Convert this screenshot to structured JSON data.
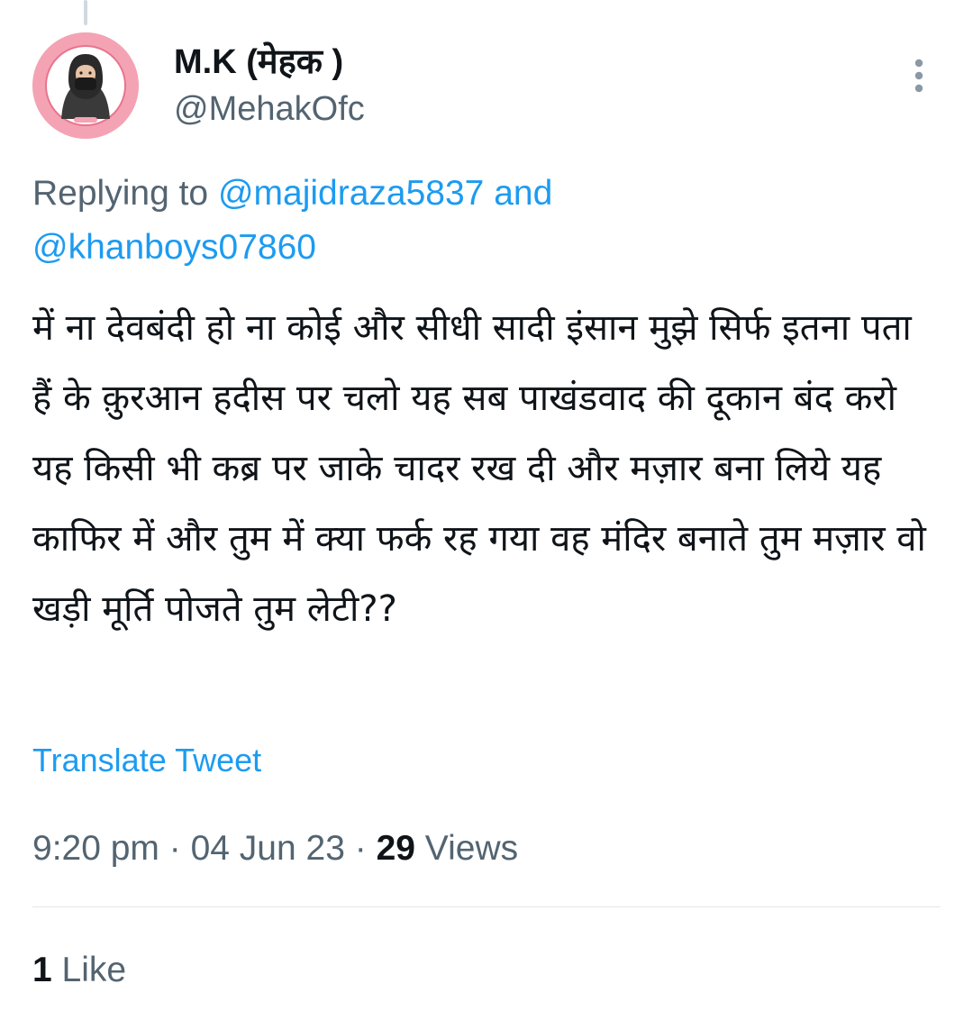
{
  "author": {
    "display_name": "M.K (मेहक )",
    "handle": "@MehakOfc",
    "avatar_icon": "hijab-profile-avatar-icon",
    "avatar_bg": "#f4a3b4"
  },
  "menu": {
    "icon": "more-vertical-icon"
  },
  "reply": {
    "prefix": "Replying to ",
    "mention_1": "@majidraza5837",
    "joiner": " and",
    "mention_2": "@khanboys07860"
  },
  "tweet": {
    "text": "में ना देवबंदी हो ना कोई और सीधी सादी इंसान मुझे सिर्फ इतना पता हैं के क़ुरआन हदीस पर चलो यह सब पाखंडवाद की दूकान बंद करो यह किसी भी कब्र पर जाके चादर रख दी और मज़ार बना लिये यह काफिर में और तुम में क्या फर्क रह गया वह मंदिर बनाते तुम मज़ार वो खड़ी मूर्ति पोजते तुम लेटी??",
    "translate_label": "Translate Tweet"
  },
  "meta": {
    "time": "9:20 pm",
    "sep_1": " · ",
    "date": "04 Jun 23",
    "sep_2": " · ",
    "views_count": "29",
    "views_label": " Views"
  },
  "stats": {
    "likes_count": "1",
    "likes_label": " Like"
  },
  "colors": {
    "link": "#1d9bf0",
    "secondary_text": "#536471",
    "primary_text": "#0f1419"
  }
}
